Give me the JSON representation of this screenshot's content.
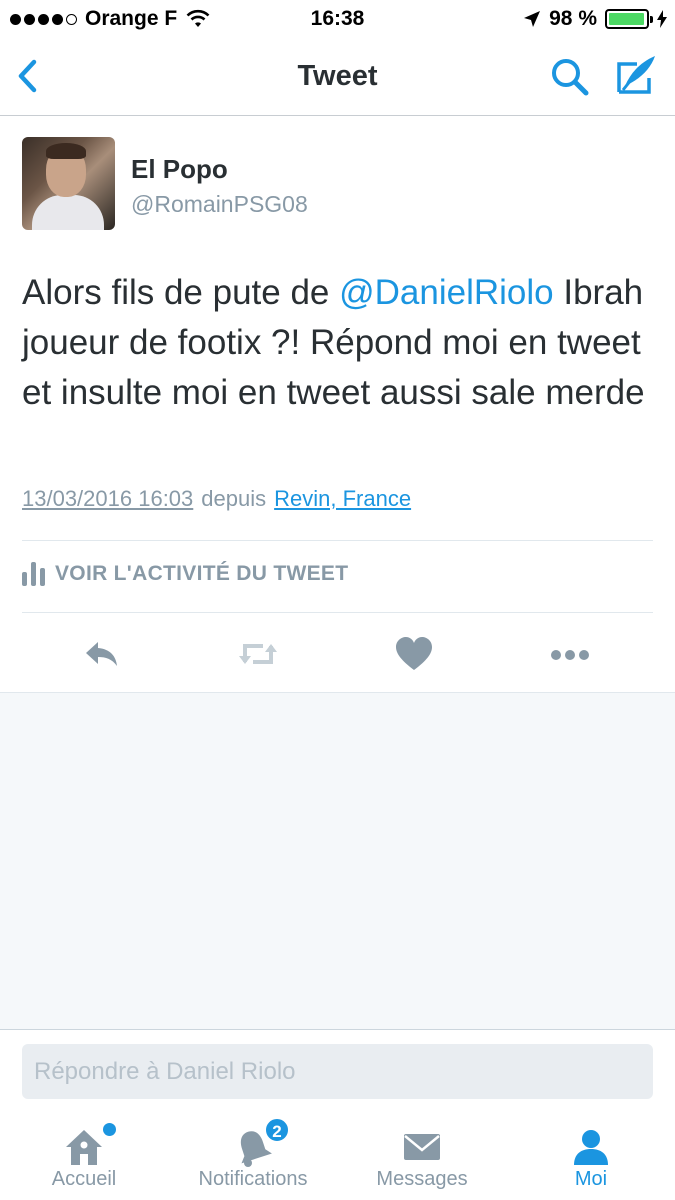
{
  "status_bar": {
    "carrier": "Orange F",
    "time": "16:38",
    "battery_percent": "98 %",
    "battery_level": 0.98,
    "signal_bars": 4
  },
  "nav": {
    "title": "Tweet",
    "back_icon": "chevron-left-icon",
    "search_icon": "search-icon",
    "compose_icon": "compose-tweet-icon",
    "accent_color": "#1b95e0"
  },
  "tweet": {
    "author_name": "El Popo",
    "author_handle": "@RomainPSG08",
    "text_before_mention": "Alors fils de pute de ",
    "mention": "@DanielRiolo",
    "text_after_mention": " Ibrah joueur de footix ?! Répond moi en tweet et insulte moi en tweet aussi sale merde",
    "date": "13/03/2016 16:03",
    "via_label": "depuis",
    "place": "Revin, France",
    "activity_label": "VOIR L'ACTIVITÉ DU TWEET"
  },
  "actions": [
    {
      "icon": "reply-icon"
    },
    {
      "icon": "retweet-icon"
    },
    {
      "icon": "like-heart-icon"
    },
    {
      "icon": "more-options-icon"
    }
  ],
  "reply": {
    "placeholder": "Répondre à Daniel Riolo"
  },
  "tab_bar": {
    "tabs": [
      {
        "label": "Accueil",
        "icon": "home-icon",
        "active": false,
        "has_dot": true
      },
      {
        "label": "Notifications",
        "icon": "bell-icon",
        "active": false,
        "badge": "2"
      },
      {
        "label": "Messages",
        "icon": "envelope-icon",
        "active": false
      },
      {
        "label": "Moi",
        "icon": "person-icon",
        "active": true
      }
    ]
  }
}
